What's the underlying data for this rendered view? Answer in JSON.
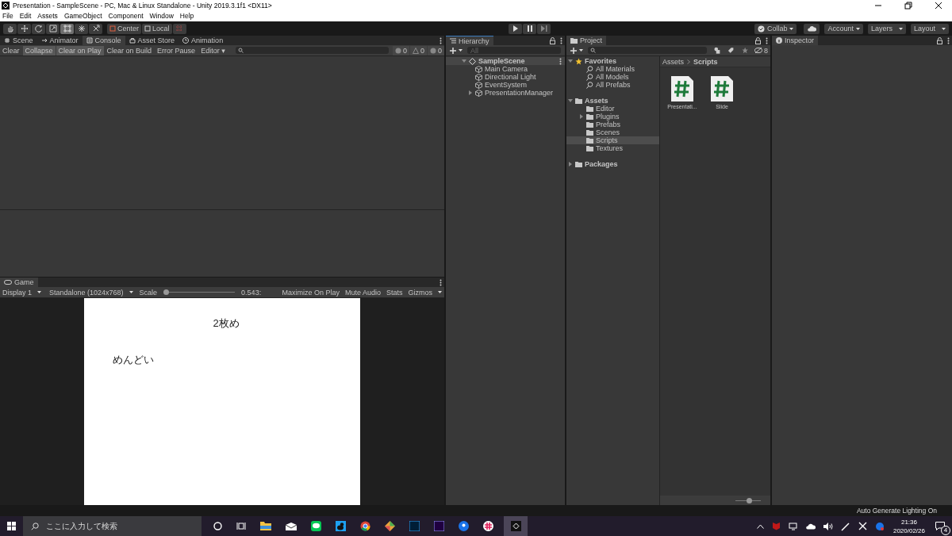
{
  "window": {
    "title": "Presentation - SampleScene - PC, Mac & Linux Standalone - Unity 2019.3.1f1 <DX11>"
  },
  "menu": [
    "File",
    "Edit",
    "Assets",
    "GameObject",
    "Component",
    "Window",
    "Help"
  ],
  "toolbar": {
    "tools": [
      {
        "selected": false
      },
      {
        "selected": false
      },
      {
        "selected": false
      },
      {
        "selected": false
      },
      {
        "selected": true
      },
      {
        "selected": false
      },
      {
        "selected": false
      }
    ],
    "pivot": [
      "Center",
      "Local"
    ],
    "right": [
      {
        "label": "Collab",
        "kind": "collab"
      },
      {
        "label": "Account",
        "kind": "dropdown"
      },
      {
        "label": "Layers",
        "kind": "dropdown"
      },
      {
        "label": "Layout",
        "kind": "dropdown"
      }
    ]
  },
  "console": {
    "tabs": [
      {
        "label": "Scene",
        "selected": false
      },
      {
        "label": "Animator",
        "selected": false
      },
      {
        "label": "Console",
        "selected": true
      },
      {
        "label": "Asset Store",
        "selected": false
      },
      {
        "label": "Animation",
        "selected": false
      }
    ],
    "buttons": [
      {
        "label": "Clear",
        "on": false
      },
      {
        "label": "Collapse",
        "on": true
      },
      {
        "label": "Clear on Play",
        "on": true
      },
      {
        "label": "Clear on Build",
        "on": false
      },
      {
        "label": "Error Pause",
        "on": false
      },
      {
        "label": "Editor ▾",
        "on": false
      }
    ],
    "counts": [
      "0",
      "0",
      "0"
    ]
  },
  "hierarchy": {
    "title": "Hierarchy",
    "search": {
      "placeholder": "All"
    },
    "scene": "SampleScene",
    "objects": [
      {
        "label": "Main Camera"
      },
      {
        "label": "Directional Light"
      },
      {
        "label": "EventSystem"
      },
      {
        "label": "PresentationManager",
        "expanded": false
      }
    ]
  },
  "project": {
    "title": "Project",
    "hidden_count": "8",
    "tree": [
      {
        "label": "Favorites",
        "kind": "favorites",
        "expanded": true,
        "selected": false,
        "children": [
          {
            "label": "All Materials",
            "kind": "search",
            "selected": false
          },
          {
            "label": "All Models",
            "kind": "search",
            "selected": false
          },
          {
            "label": "All Prefabs",
            "kind": "search",
            "selected": false
          }
        ]
      },
      {
        "label": "Assets",
        "kind": "folder",
        "expanded": true,
        "selected": false,
        "children": [
          {
            "label": "Editor",
            "kind": "folder",
            "selected": false
          },
          {
            "label": "Plugins",
            "kind": "folder",
            "expanded": false,
            "selected": false
          },
          {
            "label": "Prefabs",
            "kind": "folder",
            "selected": false
          },
          {
            "label": "Scenes",
            "kind": "folder",
            "selected": false
          },
          {
            "label": "Scripts",
            "kind": "folder",
            "selected": true
          },
          {
            "label": "Textures",
            "kind": "folder",
            "selected": false
          }
        ]
      },
      {
        "label": "Packages",
        "kind": "folder",
        "expanded": false,
        "selected": false
      }
    ],
    "breadcrumb": [
      "Assets",
      "Scripts"
    ],
    "files": [
      "Presentati...",
      "Slide"
    ],
    "zoom": {
      "level": 0.55
    }
  },
  "inspector": {
    "title": "Inspector"
  },
  "game": {
    "tab": "Game",
    "display": "Display 1",
    "resolution": "Standalone (1024x768)",
    "scale": {
      "label": "Scale",
      "level": 0,
      "reading": "0.543:"
    },
    "buttons": [
      "Maximize On Play",
      "Mute Audio",
      "Stats",
      "Gizmos"
    ],
    "slide": {
      "title": "2枚め",
      "body": "めんどい"
    }
  },
  "status_bar": "Auto Generate Lighting On",
  "taskbar": {
    "search": {
      "placeholder": "ここに入力して検索"
    },
    "time": "21:36",
    "date": "2020/02/26",
    "notifications": "4"
  }
}
